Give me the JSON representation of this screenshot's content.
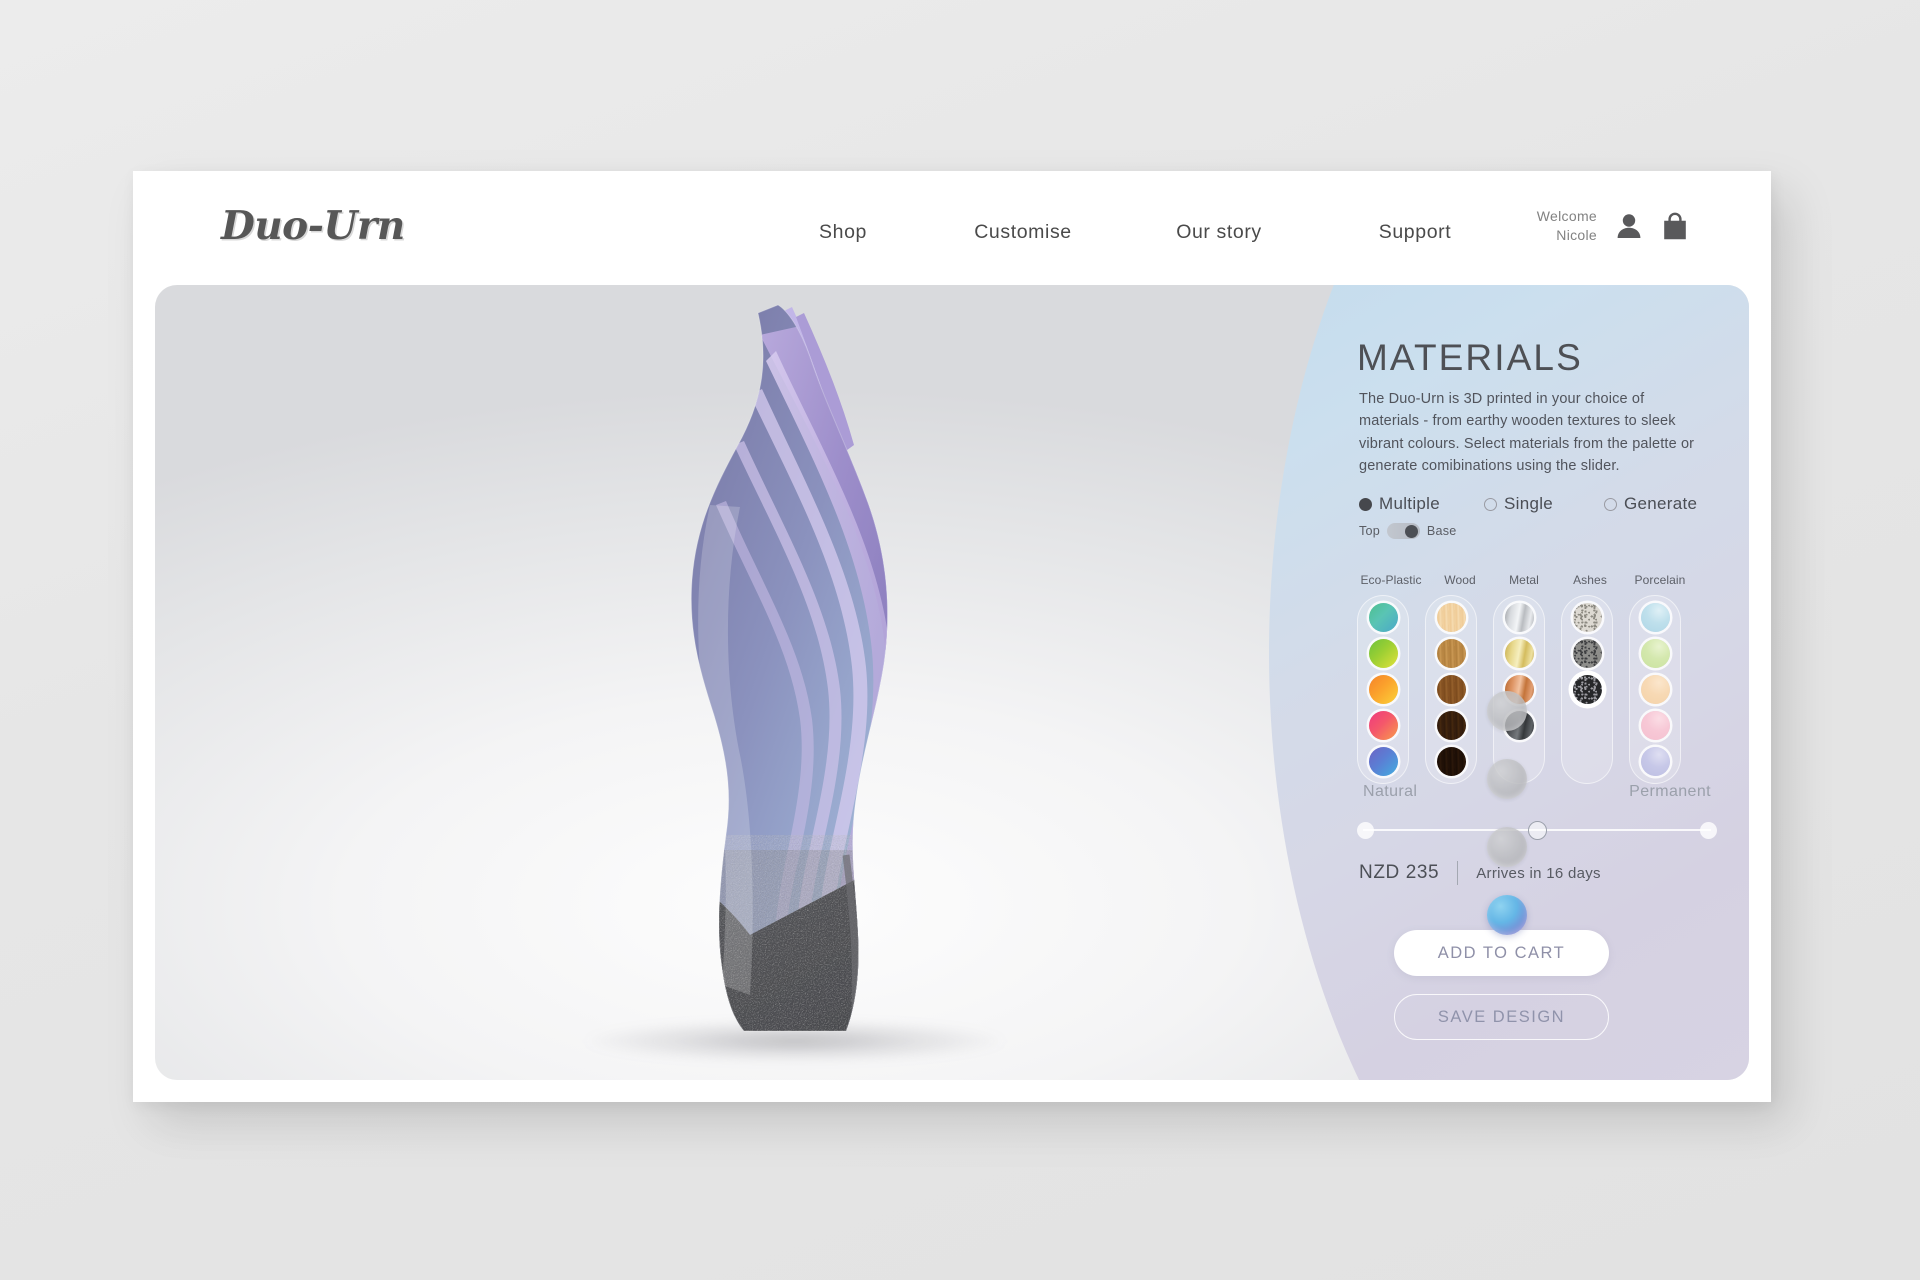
{
  "header": {
    "brand": "Duo-Urn",
    "nav": [
      {
        "label": "Shop"
      },
      {
        "label": "Customise"
      },
      {
        "label": "Our story"
      },
      {
        "label": "Support"
      }
    ],
    "welcome": "Welcome\nNicole",
    "account_icon": "person-icon",
    "cart_icon": "shopping-bag-icon"
  },
  "steps": [
    {
      "name": "step-1",
      "state": "inactive"
    },
    {
      "name": "step-2",
      "state": "inactive"
    },
    {
      "name": "step-3",
      "state": "inactive"
    },
    {
      "name": "step-4",
      "state": "active"
    }
  ],
  "panel": {
    "title": "MATERIALS",
    "description": "The Duo-Urn is 3D printed in your choice of materials - from earthy wooden textures to sleek vibrant colours. Select materials from the palette or generate comibinations using the slider.",
    "modes": [
      {
        "label": "Multiple",
        "selected": true
      },
      {
        "label": "Single",
        "selected": false
      },
      {
        "label": "Generate",
        "selected": false
      }
    ],
    "toggle": {
      "left_label": "Top",
      "right_label": "Base",
      "position": "right"
    },
    "palette": {
      "columns": [
        {
          "header": "Eco-Plastic",
          "swatches": [
            {
              "name": "eco-plastic-teal-green",
              "css": "linear-gradient(135deg,#4cc08f 0%,#5ac4b4 45%,#4aa8c8 100%)",
              "selected": false
            },
            {
              "name": "eco-plastic-green-yellow",
              "css": "linear-gradient(135deg,#6cc23c 0%,#9ccf33 45%,#e2e23c 100%)",
              "selected": false
            },
            {
              "name": "eco-plastic-orange-yellow",
              "css": "linear-gradient(135deg,#f5832a 0%,#fba22c 45%,#fbd33a 100%)",
              "selected": false
            },
            {
              "name": "eco-plastic-pink-orange",
              "css": "linear-gradient(135deg,#ef3a7e 0%,#f4576b 45%,#f89c4a 100%)",
              "selected": false
            },
            {
              "name": "eco-plastic-blue-purple",
              "css": "linear-gradient(135deg,#6d63c4 0%,#5b7ed4 45%,#43aee0 100%)",
              "selected": false
            }
          ]
        },
        {
          "header": "Wood",
          "swatches": [
            {
              "name": "wood-birch",
              "css": "repeating-linear-gradient(88deg,#f3d4a4 0px,#efcb96 2px,#f6dcb2 4px,#eecb97 6px)",
              "selected": false
            },
            {
              "name": "wood-oak",
              "css": "repeating-linear-gradient(88deg,#c08c48 0px,#b07f3d 2px,#cb9954 4px,#b2813f 6px)",
              "selected": false
            },
            {
              "name": "wood-walnut",
              "css": "repeating-linear-gradient(88deg,#8a5524 0px,#7b4a1d 2px,#96612c 4px,#7e4c1f 6px)",
              "selected": false
            },
            {
              "name": "wood-espresso",
              "css": "repeating-linear-gradient(88deg,#3b210f 0px,#2f1a0b 2px,#46290f 4px,#321b0c 6px)",
              "selected": false
            },
            {
              "name": "wood-ebony",
              "css": "repeating-linear-gradient(88deg,#241208 0px,#1a0d05 2px,#2c180a 4px,#1c0e06 6px)",
              "selected": false
            }
          ]
        },
        {
          "header": "Metal",
          "swatches": [
            {
              "name": "metal-chrome",
              "css": "linear-gradient(100deg,#9fa2a6 0%,#d7dade 22%,#f3f5f7 46%,#b9bcc0 62%,#e9ebee 82%,#a9acb0 100%)",
              "selected": false
            },
            {
              "name": "metal-gold",
              "css": "linear-gradient(100deg,#c9ae4e 0%,#e8d98e 26%,#f6efbf 48%,#d4bc5e 66%,#ede0a0 86%,#c3a748 100%)",
              "selected": false
            },
            {
              "name": "metal-copper",
              "css": "linear-gradient(100deg,#b5662e 0%,#de9463 26%,#f2c2a0 48%,#c4743a 66%,#e3a176 86%,#ab5f2a 100%)",
              "selected": false
            },
            {
              "name": "metal-gunmetal",
              "css": "linear-gradient(100deg,#2a2c2e 0%,#55585c 26%,#74787c 48%,#35383b 66%,#5e6266 86%,#26282a 100%)",
              "selected": false
            }
          ]
        },
        {
          "header": "Ashes",
          "swatches": [
            {
              "name": "ashes-light-speckle",
              "css": "#ddd9d2",
              "selected": false,
              "speckle": "light"
            },
            {
              "name": "ashes-mid-speckle",
              "css": "#8d8d8a",
              "selected": false,
              "speckle": "mid"
            },
            {
              "name": "ashes-dark-speckle",
              "css": "#262729",
              "selected": true,
              "speckle": "dark"
            }
          ]
        },
        {
          "header": "Porcelain",
          "swatches": [
            {
              "name": "porcelain-pale-blue",
              "css": "radial-gradient(circle at 62% 26%,#dff0f6 0%,#bfe0ec 45%,#aed6e6 100%)",
              "selected": false
            },
            {
              "name": "porcelain-pale-green",
              "css": "radial-gradient(circle at 62% 26%,#e8f3cf 0%,#d4e8ae 45%,#c9e29e 100%)",
              "selected": false
            },
            {
              "name": "porcelain-pale-peach",
              "css": "radial-gradient(circle at 62% 26%,#fbe6cc 0%,#f7d9b4 45%,#f5d2a8 100%)",
              "selected": false
            },
            {
              "name": "porcelain-pale-pink",
              "css": "radial-gradient(circle at 62% 26%,#fbdde5 0%,#f7c8d6 45%,#f5bfcf 100%)",
              "selected": false
            },
            {
              "name": "porcelain-pale-lavender",
              "css": "radial-gradient(circle at 62% 26%,#dfdff2 0%,#c7c8e8 45%,#bcbee2 100%)",
              "selected": false
            }
          ]
        }
      ]
    },
    "slider": {
      "left_label": "Natural",
      "right_label": "Permanent",
      "value_percent": 50
    },
    "price": "NZD 235",
    "delivery": "Arrives in 16 days",
    "add_to_cart_label": "ADD TO CART",
    "save_design_label": "SAVE DESIGN"
  },
  "product": {
    "name": "duo-urn-3d-preview",
    "top_material": "blue-purple-gradient",
    "base_material": "ashes-dark-speckle"
  }
}
